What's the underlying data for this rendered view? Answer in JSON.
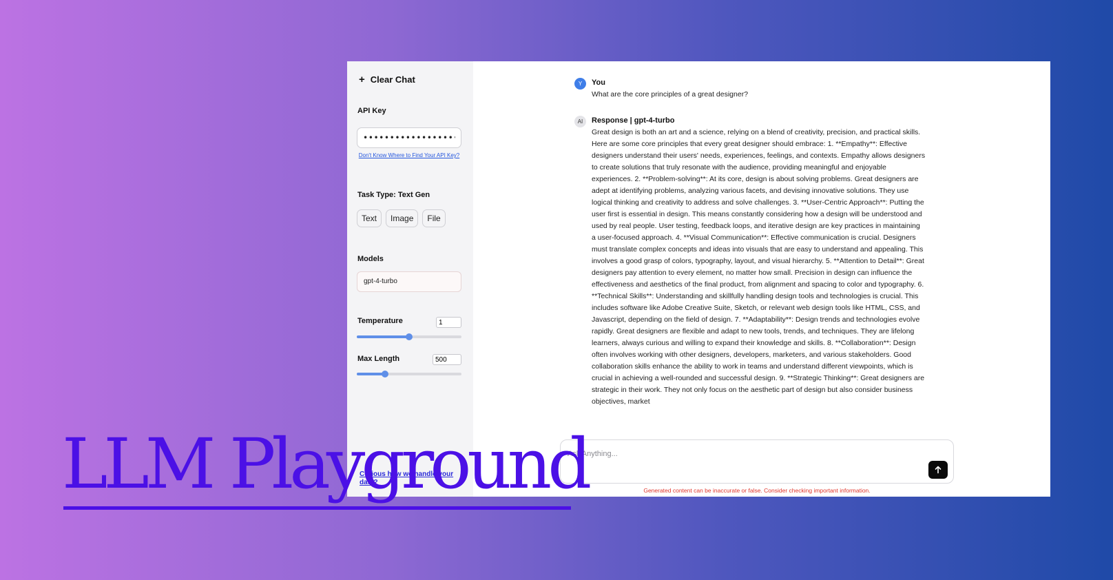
{
  "sidebar": {
    "clear_chat_label": "Clear Chat",
    "api_key": {
      "label": "API Key",
      "value": "••••••••••••••••••••••••••••",
      "help_link": "Don't Know Where to Find Your API Key?"
    },
    "task_type": {
      "label": "Task Type: Text Gen",
      "options": [
        "Text",
        "Image",
        "File"
      ],
      "selected": "Text"
    },
    "models": {
      "label": "Models",
      "selected": "gpt-4-turbo"
    },
    "temperature": {
      "label": "Temperature",
      "value": "1",
      "slider_fraction": 0.5
    },
    "max_length": {
      "label": "Max Length",
      "value": "500",
      "slider_fraction": 0.27
    },
    "curious_link": "Curious how we handle your data?"
  },
  "chat": {
    "messages": [
      {
        "avatar": "Y",
        "author": "You",
        "text": "What are the core principles of a great designer?"
      },
      {
        "avatar": "AI",
        "author": "Response | gpt-4-turbo",
        "text": "Great design is both an art and a science, relying on a blend of creativity, precision, and practical skills. Here are some core principles that every great designer should embrace: 1. **Empathy**: Effective designers understand their users' needs, experiences, feelings, and contexts. Empathy allows designers to create solutions that truly resonate with the audience, providing meaningful and enjoyable experiences. 2. **Problem-solving**: At its core, design is about solving problems. Great designers are adept at identifying problems, analyzing various facets, and devising innovative solutions. They use logical thinking and creativity to address and solve challenges. 3. **User-Centric Approach**: Putting the user first is essential in design. This means constantly considering how a design will be understood and used by real people. User testing, feedback loops, and iterative design are key practices in maintaining a user-focused approach. 4. **Visual Communication**: Effective communication is crucial. Designers must translate complex concepts and ideas into visuals that are easy to understand and appealing. This involves a good grasp of colors, typography, layout, and visual hierarchy. 5. **Attention to Detail**: Great designers pay attention to every element, no matter how small. Precision in design can influence the effectiveness and aesthetics of the final product, from alignment and spacing to color and typography. 6. **Technical Skills**: Understanding and skillfully handling design tools and technologies is crucial. This includes software like Adobe Creative Suite, Sketch, or relevant web design tools like HTML, CSS, and Javascript, depending on the field of design. 7. **Adaptability**: Design trends and technologies evolve rapidly. Great designers are flexible and adapt to new tools, trends, and techniques. They are lifelong learners, always curious and willing to expand their knowledge and skills. 8. **Collaboration**: Design often involves working with other designers, developers, marketers, and various stakeholders. Good collaboration skills enhance the ability to work in teams and understand different viewpoints, which is crucial in achieving a well-rounded and successful design. 9. **Strategic Thinking**: Great designers are strategic in their work. They not only focus on the aesthetic part of design but also consider business objectives, market"
      }
    ]
  },
  "composer": {
    "placeholder": "Ask Anything...",
    "send_icon": "arrow-up-icon",
    "disclaimer": "Generated content can be inaccurate or false. Consider checking important information."
  },
  "hero": {
    "title": "LLM Playground"
  },
  "colors": {
    "accent_blue": "#5f8fe8",
    "hero_purple": "#4b10e6",
    "disclaimer_red": "#e0352b",
    "background_gradient": [
      "#bc72e3",
      "#1f4aa8"
    ]
  }
}
